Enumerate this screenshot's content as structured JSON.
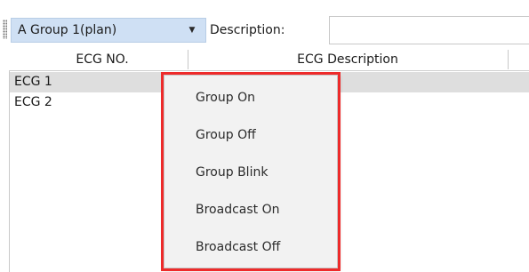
{
  "toolbar": {
    "group_value": "A Group 1(plan)",
    "description_label": "Description:",
    "description_value": ""
  },
  "grid": {
    "columns": [
      "ECG NO.",
      "ECG Description"
    ],
    "rows": [
      {
        "ecg_no": "ECG 1",
        "description": ""
      },
      {
        "ecg_no": "ECG 2",
        "description": ""
      }
    ]
  },
  "context_menu": {
    "items": [
      "Group On",
      "Group Off",
      "Group Blink",
      "Broadcast On",
      "Broadcast Off"
    ]
  },
  "colors": {
    "highlight": "#ee2b2b",
    "combo_background": "#cfe0f4",
    "selected_row": "#dedede"
  },
  "icons": {
    "combo_arrow": "chevron-down-icon",
    "toolbar_grip": "grip-icon"
  }
}
